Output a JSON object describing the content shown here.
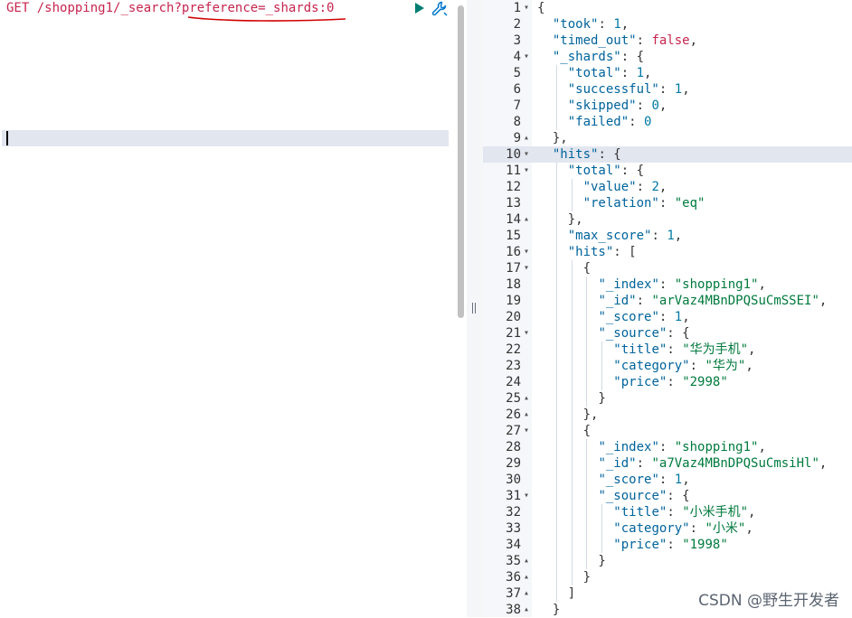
{
  "request": {
    "method": "GET",
    "path_prefix": "/shopping1/_search?",
    "path_highlight": "preference=_shards:0"
  },
  "icons": {
    "run": "play-icon",
    "settings": "wrench-icon"
  },
  "colors": {
    "key": "#00639c",
    "string": "#007a3d",
    "number": "#0079a5",
    "boolean": "#c7254e",
    "annotation": "#d00000"
  },
  "response_lines": [
    {
      "n": "1",
      "fold": "▾",
      "code": "{"
    },
    {
      "n": "2",
      "fold": "",
      "code": "  \"took\": 1,"
    },
    {
      "n": "3",
      "fold": "",
      "code": "  \"timed_out\": false,"
    },
    {
      "n": "4",
      "fold": "▾",
      "code": "  \"_shards\": {"
    },
    {
      "n": "5",
      "fold": "",
      "code": "    \"total\": 1,"
    },
    {
      "n": "6",
      "fold": "",
      "code": "    \"successful\": 1,"
    },
    {
      "n": "7",
      "fold": "",
      "code": "    \"skipped\": 0,"
    },
    {
      "n": "8",
      "fold": "",
      "code": "    \"failed\": 0"
    },
    {
      "n": "9",
      "fold": "▴",
      "code": "  },"
    },
    {
      "n": "10",
      "fold": "▾",
      "code": "  \"hits\": {"
    },
    {
      "n": "11",
      "fold": "▾",
      "code": "    \"total\": {"
    },
    {
      "n": "12",
      "fold": "",
      "code": "      \"value\": 2,"
    },
    {
      "n": "13",
      "fold": "",
      "code": "      \"relation\": \"eq\""
    },
    {
      "n": "14",
      "fold": "▴",
      "code": "    },"
    },
    {
      "n": "15",
      "fold": "",
      "code": "    \"max_score\": 1,"
    },
    {
      "n": "16",
      "fold": "▾",
      "code": "    \"hits\": ["
    },
    {
      "n": "17",
      "fold": "▾",
      "code": "      {"
    },
    {
      "n": "18",
      "fold": "",
      "code": "        \"_index\": \"shopping1\","
    },
    {
      "n": "19",
      "fold": "",
      "code": "        \"_id\": \"arVaz4MBnDPQSuCmSSEI\","
    },
    {
      "n": "20",
      "fold": "",
      "code": "        \"_score\": 1,"
    },
    {
      "n": "21",
      "fold": "▾",
      "code": "        \"_source\": {"
    },
    {
      "n": "22",
      "fold": "",
      "code": "          \"title\": \"华为手机\","
    },
    {
      "n": "23",
      "fold": "",
      "code": "          \"category\": \"华为\","
    },
    {
      "n": "24",
      "fold": "",
      "code": "          \"price\": \"2998\""
    },
    {
      "n": "25",
      "fold": "▴",
      "code": "        }"
    },
    {
      "n": "26",
      "fold": "▴",
      "code": "      },"
    },
    {
      "n": "27",
      "fold": "▾",
      "code": "      {"
    },
    {
      "n": "28",
      "fold": "",
      "code": "        \"_index\": \"shopping1\","
    },
    {
      "n": "29",
      "fold": "",
      "code": "        \"_id\": \"a7Vaz4MBnDPQSuCmsiHl\","
    },
    {
      "n": "30",
      "fold": "",
      "code": "        \"_score\": 1,"
    },
    {
      "n": "31",
      "fold": "▾",
      "code": "        \"_source\": {"
    },
    {
      "n": "32",
      "fold": "",
      "code": "          \"title\": \"小米手机\","
    },
    {
      "n": "33",
      "fold": "",
      "code": "          \"category\": \"小米\","
    },
    {
      "n": "34",
      "fold": "",
      "code": "          \"price\": \"1998\""
    },
    {
      "n": "35",
      "fold": "▴",
      "code": "        }"
    },
    {
      "n": "36",
      "fold": "▴",
      "code": "      }"
    },
    {
      "n": "37",
      "fold": "▴",
      "code": "    ]"
    },
    {
      "n": "38",
      "fold": "▴",
      "code": "  }"
    }
  ],
  "watermark": "CSDN @野生开发者"
}
